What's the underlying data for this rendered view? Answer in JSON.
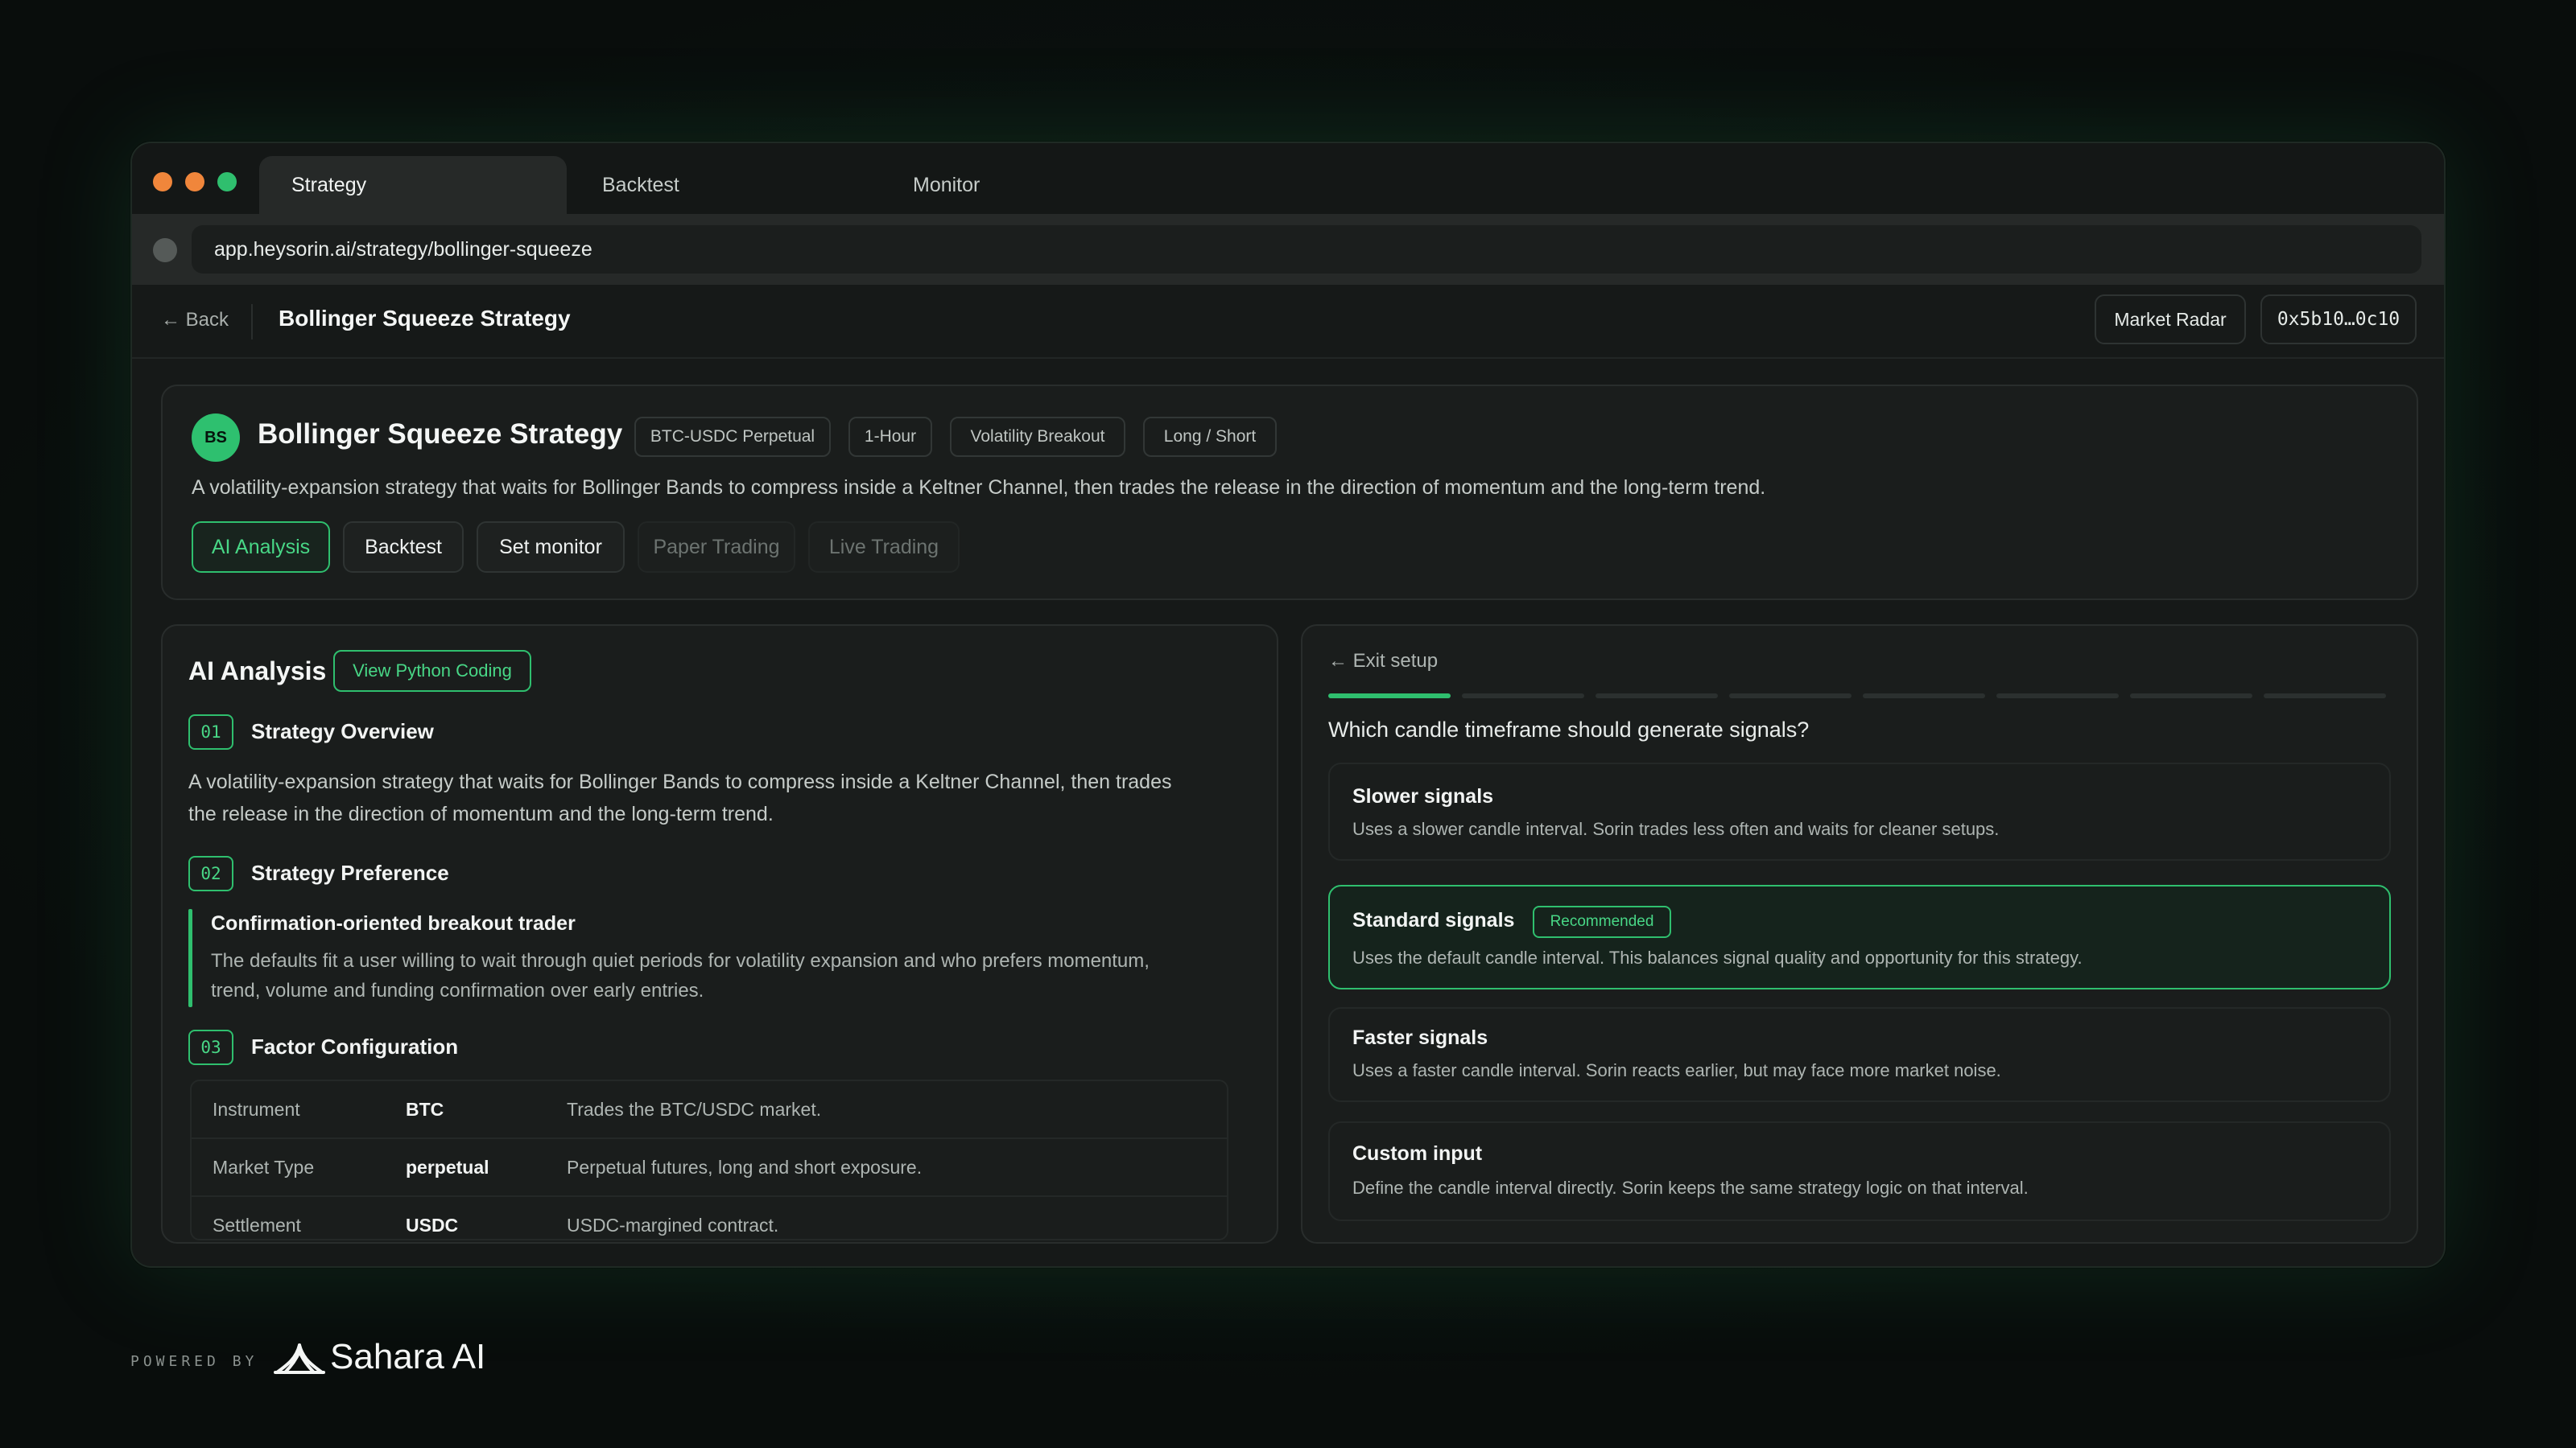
{
  "tabs": [
    {
      "label": "Strategy",
      "active": true
    },
    {
      "label": "Backtest",
      "active": false
    },
    {
      "label": "Monitor",
      "active": false
    }
  ],
  "url": "app.heysorin.ai/strategy/bollinger-squeeze",
  "header": {
    "back": "← Back",
    "title": "Bollinger Squeeze Strategy",
    "market_radar": "Market Radar",
    "wallet": "0x5b10…0c10"
  },
  "strategy": {
    "avatar": "BS",
    "title": "Bollinger Squeeze Strategy",
    "chips": [
      "BTC-USDC Perpetual",
      "1-Hour",
      "Volatility Breakout",
      "Long / Short"
    ],
    "description": "A volatility-expansion strategy that waits for Bollinger Bands to compress inside a Keltner Channel, then trades the release in the direction of momentum and the long-term trend.",
    "actions": [
      "AI Analysis",
      "Backtest",
      "Set monitor",
      "Paper Trading",
      "Live Trading"
    ]
  },
  "analysis": {
    "title": "AI Analysis",
    "code_button": "View Python Coding",
    "sections": [
      {
        "num": "01",
        "title": "Strategy Overview"
      },
      {
        "num": "02",
        "title": "Strategy Preference"
      },
      {
        "num": "03",
        "title": "Factor Configuration"
      }
    ],
    "overview_lines": [
      "A volatility-expansion strategy that waits for Bollinger Bands to compress inside a Keltner Channel, then trades",
      "the release in the direction of momentum and the long-term trend."
    ],
    "preference_title": "Confirmation-oriented breakout trader",
    "preference_lines": [
      "The defaults fit a user willing to wait through quiet periods for volatility expansion and who prefers momentum,",
      "trend, volume and funding confirmation over early entries."
    ],
    "factors": [
      {
        "name": "Instrument",
        "value": "BTC",
        "desc": "Trades the BTC/USDC market."
      },
      {
        "name": "Market Type",
        "value": "perpetual",
        "desc": "Perpetual futures, long and short exposure."
      },
      {
        "name": "Settlement",
        "value": "USDC",
        "desc": "USDC-margined contract."
      }
    ]
  },
  "setup": {
    "exit": "← Exit setup",
    "step": 1,
    "total_steps": 8,
    "question": "Which candle timeframe should generate signals?",
    "options": [
      {
        "title": "Slower signals",
        "desc": "Uses a slower candle interval. Sorin trades less often and waits for cleaner setups.",
        "selected": false
      },
      {
        "title": "Standard signals",
        "badge": "Recommended",
        "desc": "Uses the default candle interval. This balances signal quality and opportunity for this strategy.",
        "selected": true
      },
      {
        "title": "Faster signals",
        "desc": "Uses a faster candle interval. Sorin reacts earlier, but may face more market noise.",
        "selected": false
      },
      {
        "title": "Custom input",
        "desc": "Define the candle interval directly. Sorin keeps the same strategy logic on that interval.",
        "selected": false
      }
    ]
  },
  "footer": {
    "powered_by": "POWERED BY",
    "brand": "Sahara AI"
  },
  "colors": {
    "accent": "#2fbf6e",
    "background": "#0b1511",
    "panel": "#1a1d1c"
  }
}
